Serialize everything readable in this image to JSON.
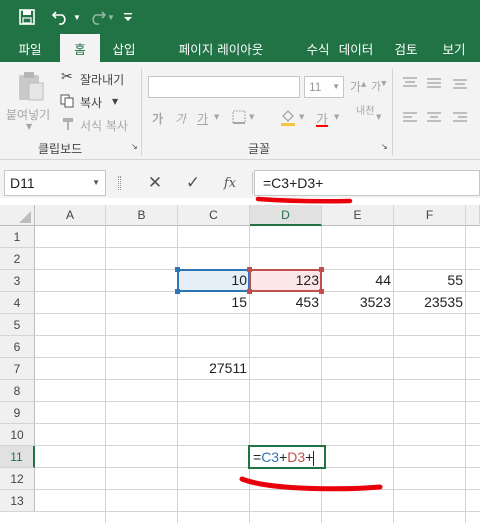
{
  "qat": {
    "save_icon": "save-icon",
    "undo_icon": "undo-icon",
    "redo_icon": "redo-icon",
    "customize_icon": "customize-qat-icon"
  },
  "tabs": [
    {
      "label": "파일"
    },
    {
      "label": "홈"
    },
    {
      "label": "삽입"
    },
    {
      "label": "페이지 레이아웃"
    },
    {
      "label": "수식"
    },
    {
      "label": "데이터"
    },
    {
      "label": "검토"
    },
    {
      "label": "보기"
    }
  ],
  "ribbon": {
    "clipboard": {
      "paste_label": "붙여넣기",
      "cut_label": "잘라내기",
      "copy_label": "복사",
      "format_painter_label": "서식 복사",
      "group_label": "클립보드"
    },
    "font": {
      "font_name": "",
      "font_size": "11",
      "group_label": "글꼴",
      "phonetic_label": "내천"
    }
  },
  "formula_bar": {
    "name_box": "D11",
    "formula": "=C3+D3+",
    "cancel_icon": "cancel-icon",
    "enter_icon": "check-icon",
    "fx_label": "fx"
  },
  "sheet": {
    "columns": [
      "A",
      "B",
      "C",
      "D",
      "E",
      "F"
    ],
    "rows": [
      "1",
      "2",
      "3",
      "4",
      "5",
      "6",
      "7",
      "8",
      "9",
      "10",
      "11",
      "12",
      "13"
    ],
    "cells": {
      "C3": "10",
      "D3": "123",
      "E3": "44",
      "F3": "55",
      "C4": "15",
      "D4": "453",
      "E4": "3523",
      "F4": "23535",
      "C7": "27511"
    },
    "edit_cell": {
      "eq": "=",
      "ref1": "C3",
      "plus1": "+",
      "ref2": "D3",
      "plus2": "+"
    },
    "active_cell": "D11"
  },
  "colors": {
    "excel_green": "#217346",
    "ref_blue": "#2e75b6",
    "ref_red": "#c0504d",
    "annotation_red": "#e8000b"
  }
}
